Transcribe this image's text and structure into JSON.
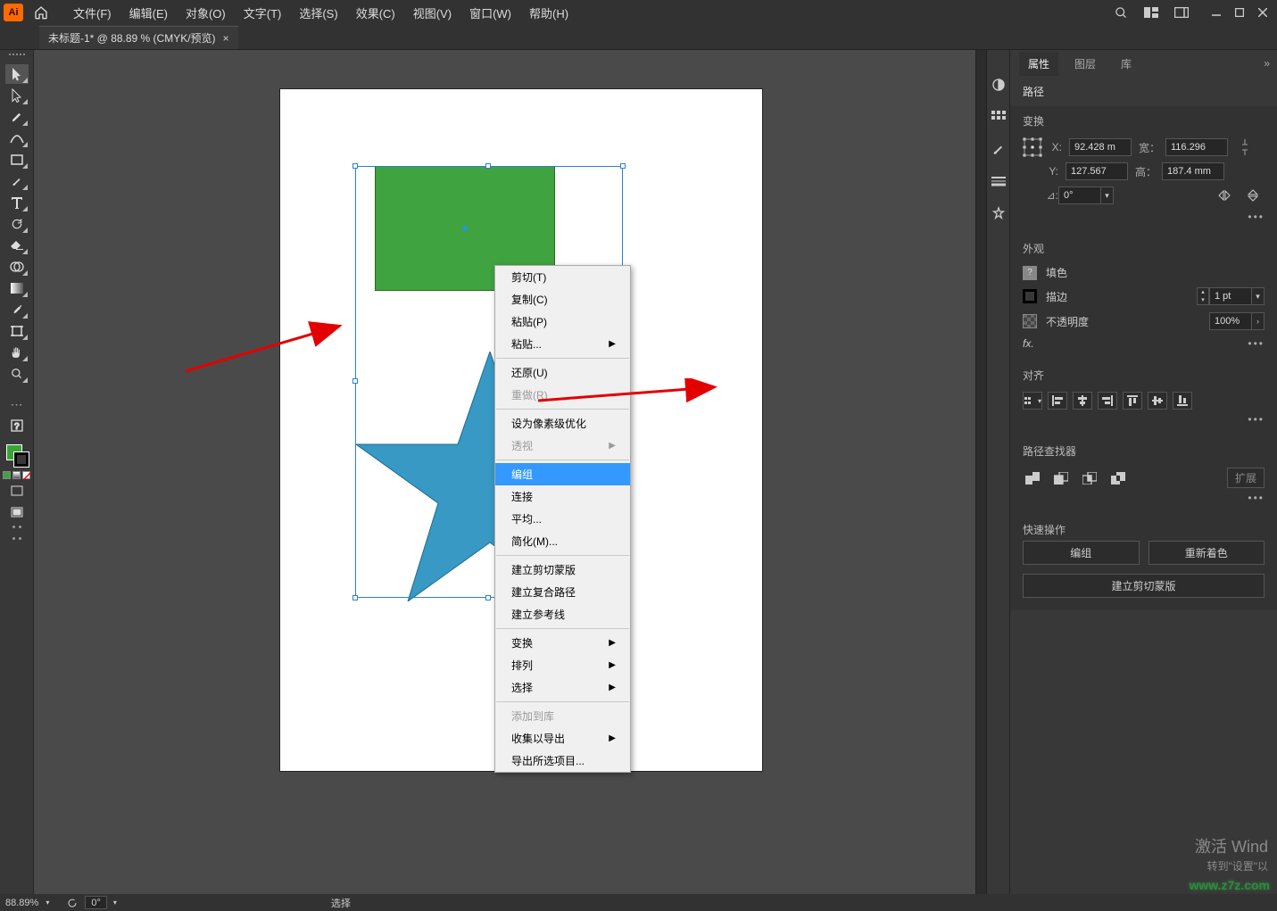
{
  "app": {
    "logo_text": "Ai"
  },
  "menus": [
    "文件(F)",
    "编辑(E)",
    "对象(O)",
    "文字(T)",
    "选择(S)",
    "效果(C)",
    "视图(V)",
    "窗口(W)",
    "帮助(H)"
  ],
  "document_tab": {
    "title": "未标题-1* @ 88.89 % (CMYK/预览)"
  },
  "context_menu": {
    "items": [
      {
        "label": "剪切(T)",
        "submenu": false
      },
      {
        "label": "复制(C)",
        "submenu": false
      },
      {
        "label": "粘贴(P)",
        "submenu": false
      },
      {
        "label": "粘贴...",
        "submenu": true
      },
      {
        "sep": true
      },
      {
        "label": "还原(U)",
        "submenu": false
      },
      {
        "label": "重做(R)",
        "submenu": false,
        "disabled": true
      },
      {
        "sep": true
      },
      {
        "label": "设为像素级优化",
        "submenu": false
      },
      {
        "label": "透视",
        "submenu": true,
        "disabled": true
      },
      {
        "sep": true
      },
      {
        "label": "编组",
        "submenu": false,
        "highlight": true
      },
      {
        "label": "连接",
        "submenu": false
      },
      {
        "label": "平均...",
        "submenu": false
      },
      {
        "label": "简化(M)...",
        "submenu": false
      },
      {
        "sep": true
      },
      {
        "label": "建立剪切蒙版",
        "submenu": false
      },
      {
        "label": "建立复合路径",
        "submenu": false
      },
      {
        "label": "建立参考线",
        "submenu": false
      },
      {
        "sep": true
      },
      {
        "label": "变换",
        "submenu": true
      },
      {
        "label": "排列",
        "submenu": true
      },
      {
        "label": "选择",
        "submenu": true
      },
      {
        "sep": true
      },
      {
        "label": "添加到库",
        "submenu": false,
        "disabled": true
      },
      {
        "label": "收集以导出",
        "submenu": true
      },
      {
        "label": "导出所选项目...",
        "submenu": false
      }
    ]
  },
  "properties": {
    "tabs": [
      "属性",
      "图层",
      "库"
    ],
    "object_type": "路径",
    "transform": {
      "title": "变换",
      "x_label": "X:",
      "x_value": "92.428 m",
      "y_label": "Y:",
      "y_value": "127.567",
      "w_label": "宽：",
      "w_value": "116.296",
      "h_label": "高：",
      "h_value": "187.4 mm",
      "angle_label": "⊿:",
      "angle_value": "0°"
    },
    "appearance": {
      "title": "外观",
      "fill_label": "填色",
      "stroke_label": "描边",
      "stroke_value": "1 pt",
      "opacity_label": "不透明度",
      "opacity_value": "100%",
      "fx_label": "fx."
    },
    "align": {
      "title": "对齐"
    },
    "pathfinder": {
      "title": "路径查找器",
      "expand_label": "扩展"
    },
    "quick": {
      "title": "快速操作",
      "group_btn": "编组",
      "recolor_btn": "重新着色",
      "clipmask_btn": "建立剪切蒙版"
    }
  },
  "statusbar": {
    "zoom": "88.89%",
    "angle": "0°",
    "selection": "选择"
  },
  "activate": {
    "line1": "激活 Wind",
    "line2": "转到\"设置\"以"
  }
}
